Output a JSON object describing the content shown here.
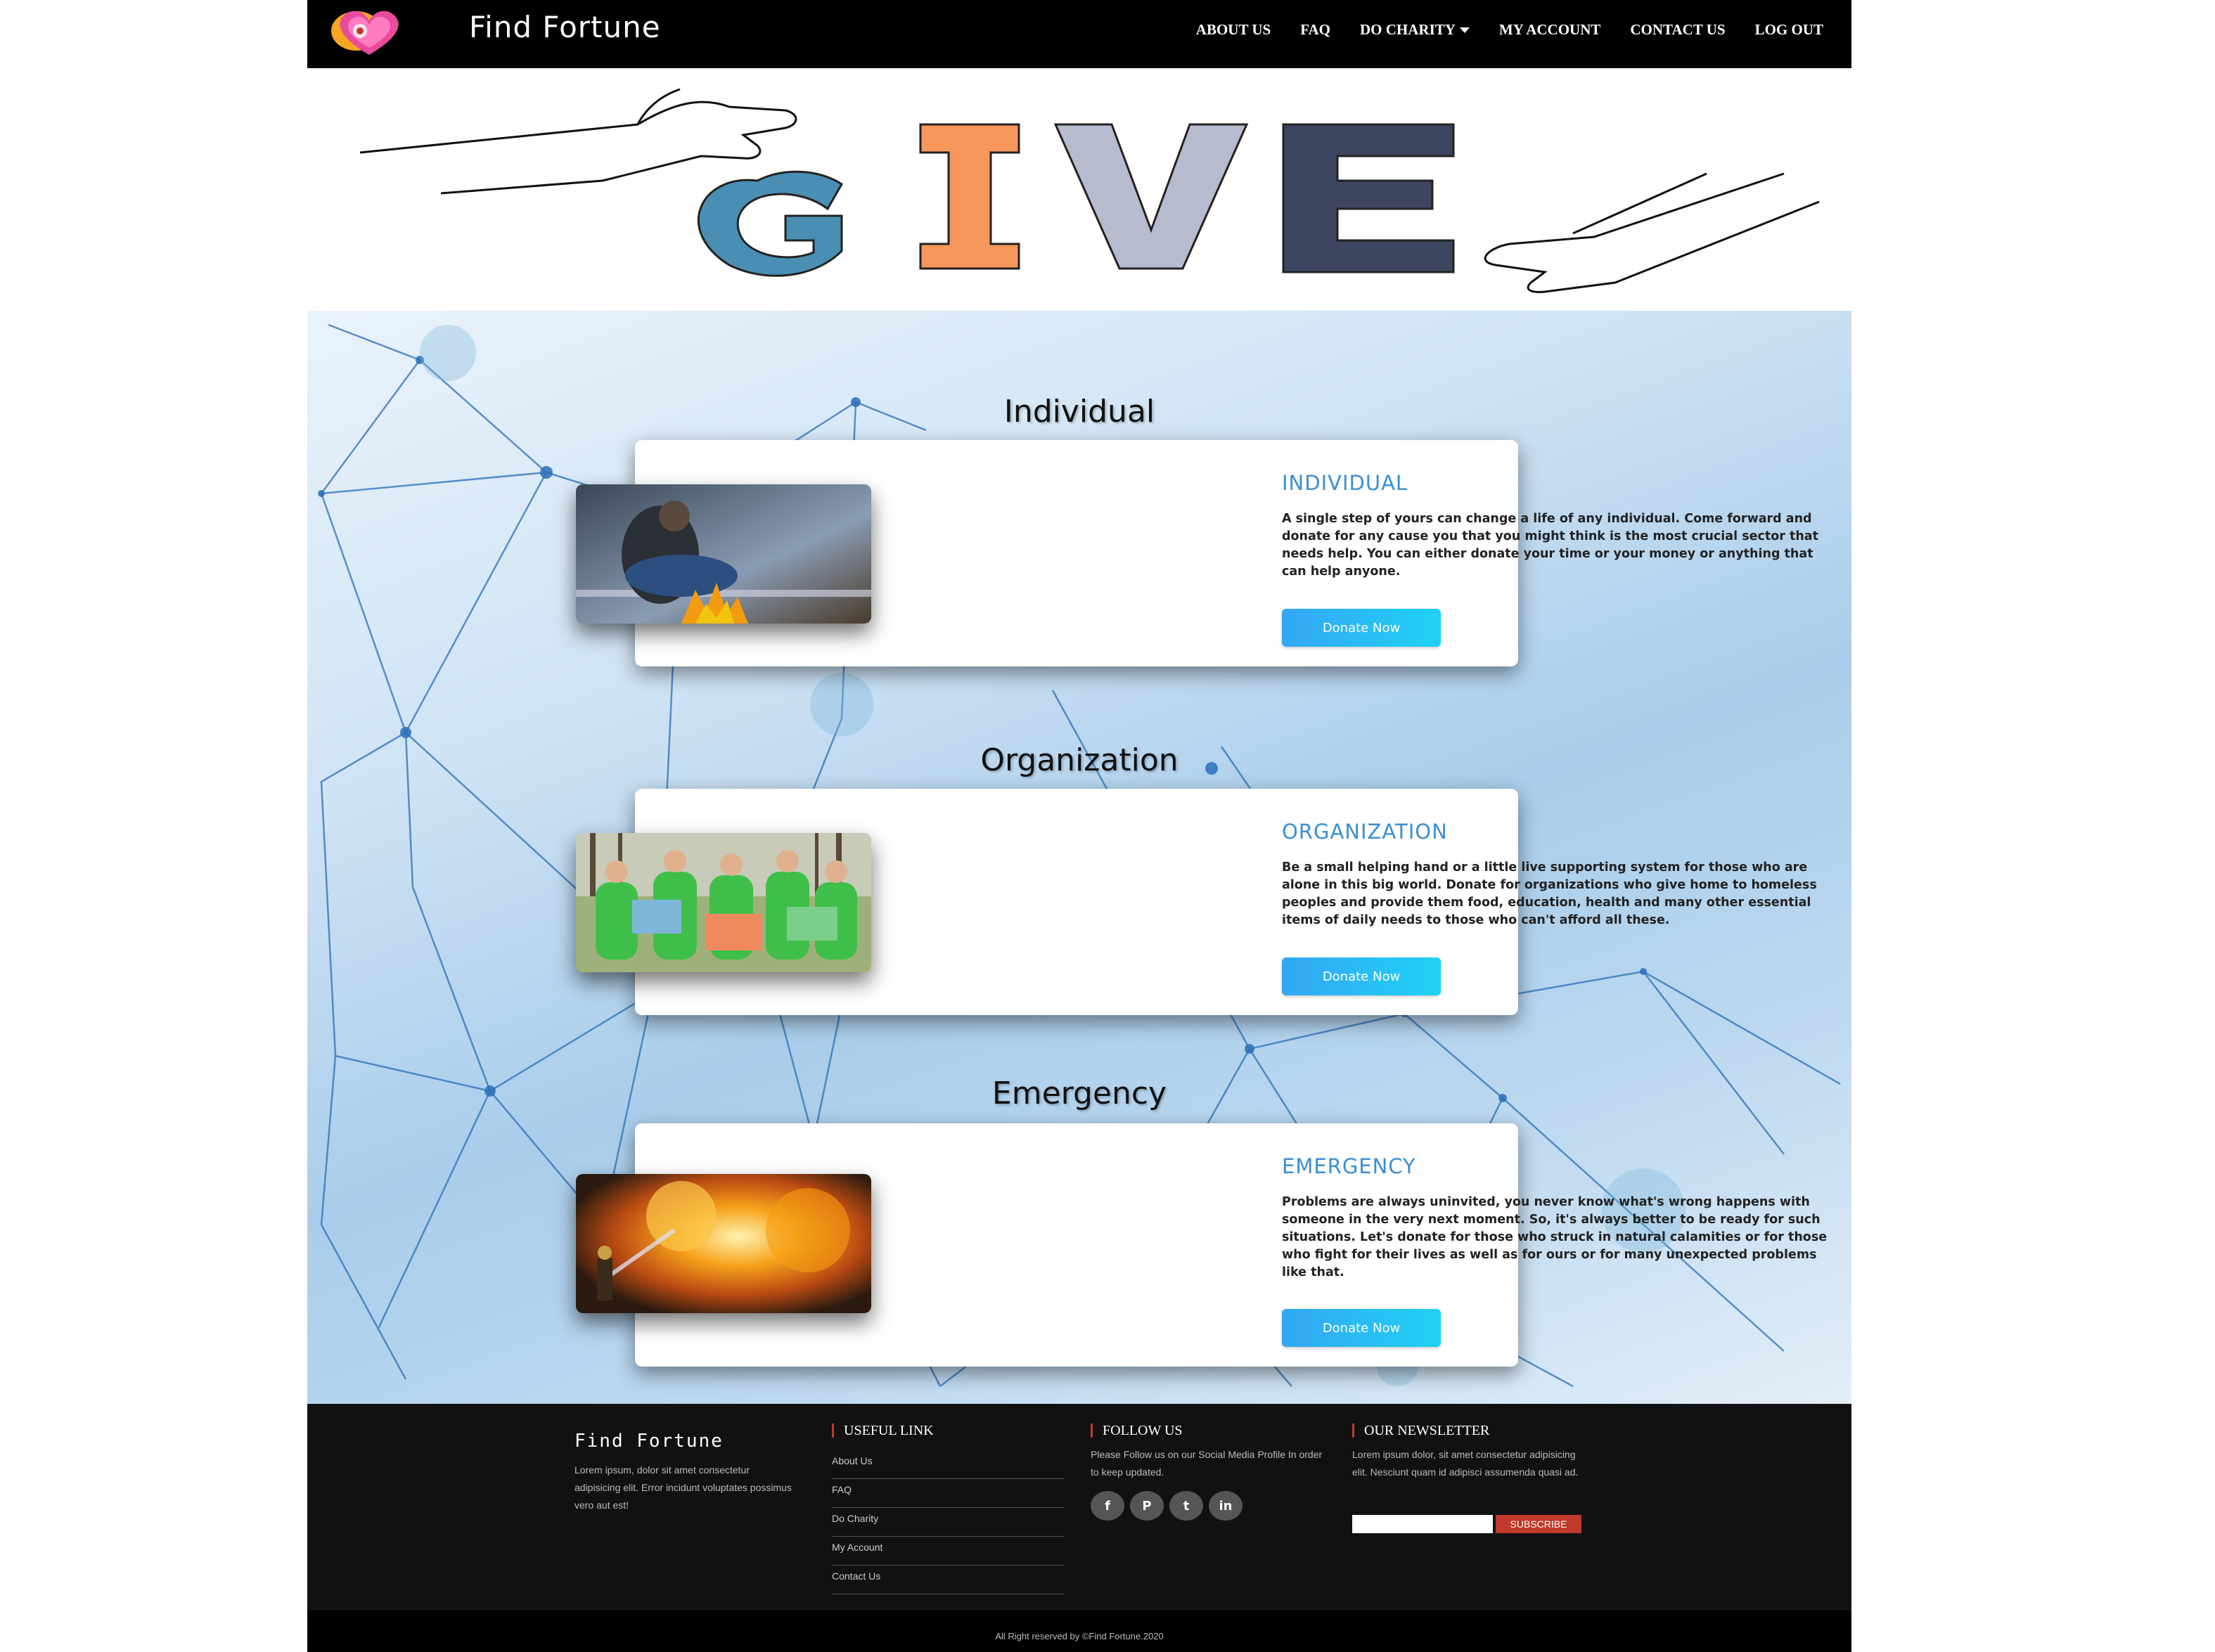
{
  "nav": {
    "brand": "Find Fortune",
    "links": [
      "ABOUT US",
      "FAQ",
      "DO CHARITY",
      "MY ACCOUNT",
      "CONTACT US",
      "LOG OUT"
    ]
  },
  "hero": {
    "letters": [
      "G",
      "I",
      "V",
      "E"
    ],
    "letter_colors": [
      "#4a8fb3",
      "#f5975a",
      "#b6bccd",
      "#3e4560"
    ]
  },
  "sections": [
    {
      "title": "Individual",
      "heading": "INDIVIDUAL",
      "text": "A single step of yours can change a life of any individual. Come forward and donate for any cause you that you might think is the most crucial sector that needs help. You can either donate your time or your money or anything that can help anyone.",
      "button": "Donate Now"
    },
    {
      "title": "Organization",
      "heading": "ORGANIZATION",
      "text": "Be a small helping hand or a little live supporting system for those who are alone in this big world. Donate for organizations who give home to homeless peoples and provide them food, education, health and many other essential items of daily needs to those who can't afford all these.",
      "button": "Donate Now"
    },
    {
      "title": "Emergency",
      "heading": "EMERGENCY",
      "text": "Problems are always uninvited, you never know what's wrong happens with someone in the very next moment. So, it's always better to be ready for such situations. Let's donate for those who struck in natural calamities or for those who fight for their lives as well as for ours or for many unexpected problems like that.",
      "button": "Donate Now"
    }
  ],
  "footer": {
    "brand": "Find Fortune",
    "desc": "Lorem ipsum, dolor sit amet consectetur adipisicing elit. Error incidunt voluptates possimus vero aut est!",
    "useful_title": "USEFUL LINK",
    "useful_links": [
      "About Us",
      "FAQ",
      "Do Charity",
      "My Account",
      "Contact Us"
    ],
    "follow_title": "FOLLOW US",
    "follow_text": "Please Follow us on our Social Media Profile In order to keep updated.",
    "social_icons": [
      "facebook-icon",
      "pinterest-icon",
      "twitter-icon",
      "linkedin-icon"
    ],
    "newsletter_title": "OUR NEWSLETTER",
    "newsletter_text": "Lorem ipsum dolor, sit amet consectetur adipisicing elit. Nesciunt quam id adipisci assumenda quasi ad.",
    "subscribe": "SUBSCRIBE",
    "copyright": "All Right reserved by ©Find Fortune.2020"
  }
}
